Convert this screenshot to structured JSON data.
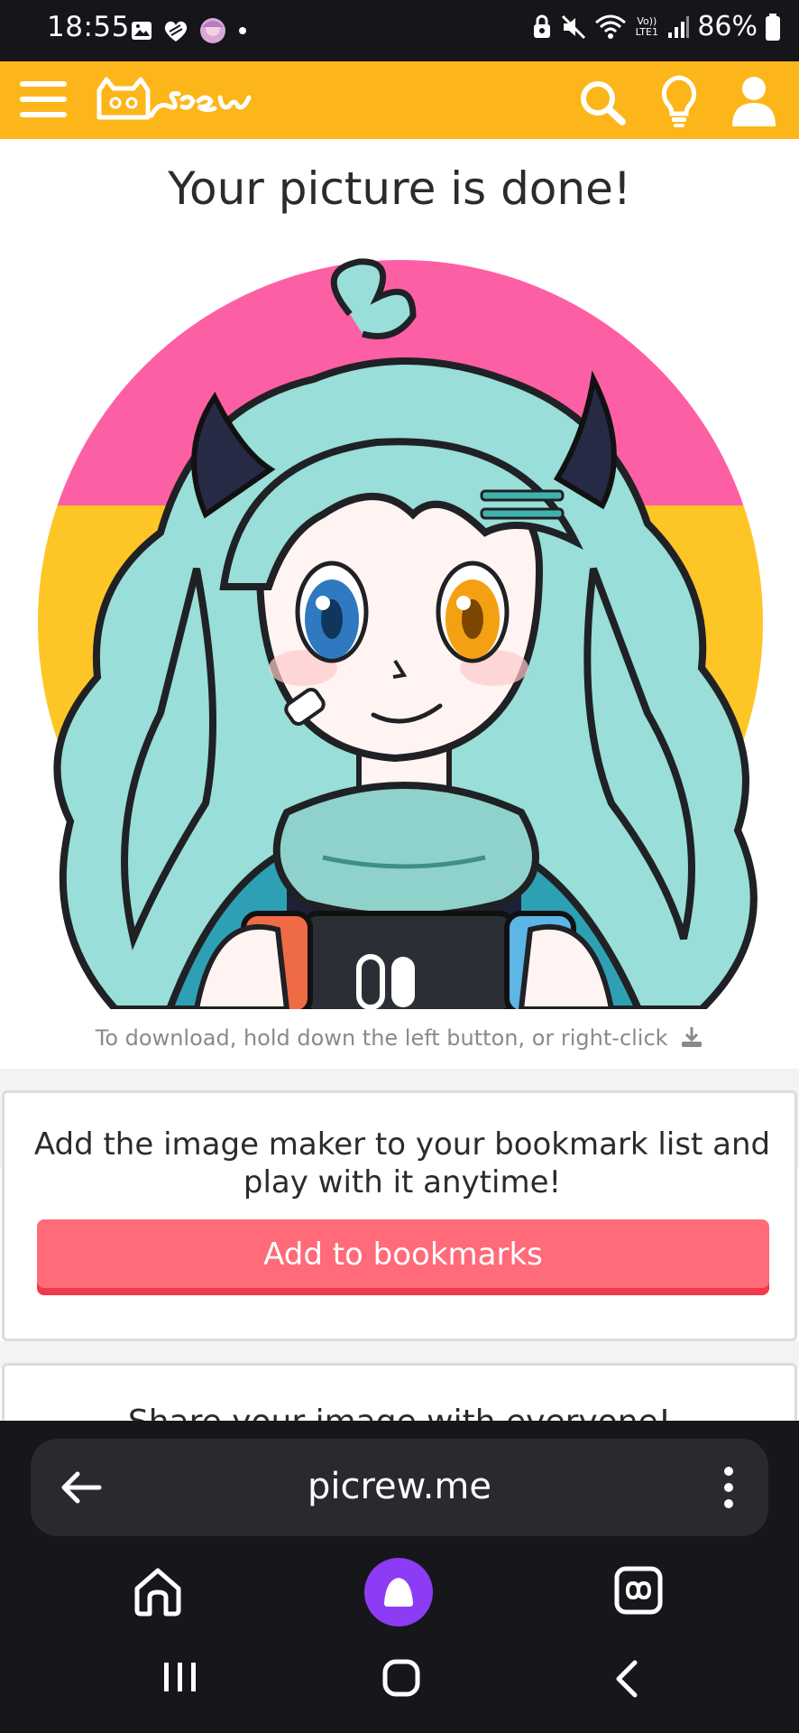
{
  "status_bar": {
    "time": "18:55",
    "volte": "Vo)) LTE1",
    "battery": "86%",
    "icons": [
      "gallery-icon",
      "heart-icon",
      "avatar-icon",
      "dot-icon",
      "lock-icon",
      "mute-icon",
      "wifi-icon",
      "volte-icon",
      "signal-icon",
      "battery-icon"
    ]
  },
  "header": {
    "logo": "Picrew",
    "icons": [
      "menu-icon",
      "search-icon",
      "lightbulb-icon",
      "user-icon"
    ],
    "brand_color": "#fcb61a"
  },
  "main": {
    "title": "Your picture is done!",
    "download_hint": "To download, hold down the left button, or right-click",
    "bookmark": {
      "text": "Add the image maker to your bookmark list and play with it anytime!",
      "button_label": "Add to bookmarks",
      "button_color": "#ff6b79"
    },
    "share": {
      "text": "Share your image with everyone!"
    }
  },
  "browser": {
    "url": "picrew.me",
    "icons": [
      "back-arrow-icon",
      "more-icon",
      "home-icon",
      "alice-icon",
      "tabs-icon"
    ]
  },
  "system_nav": {
    "icons": [
      "recent-apps-icon",
      "home-button-icon",
      "back-icon"
    ]
  }
}
